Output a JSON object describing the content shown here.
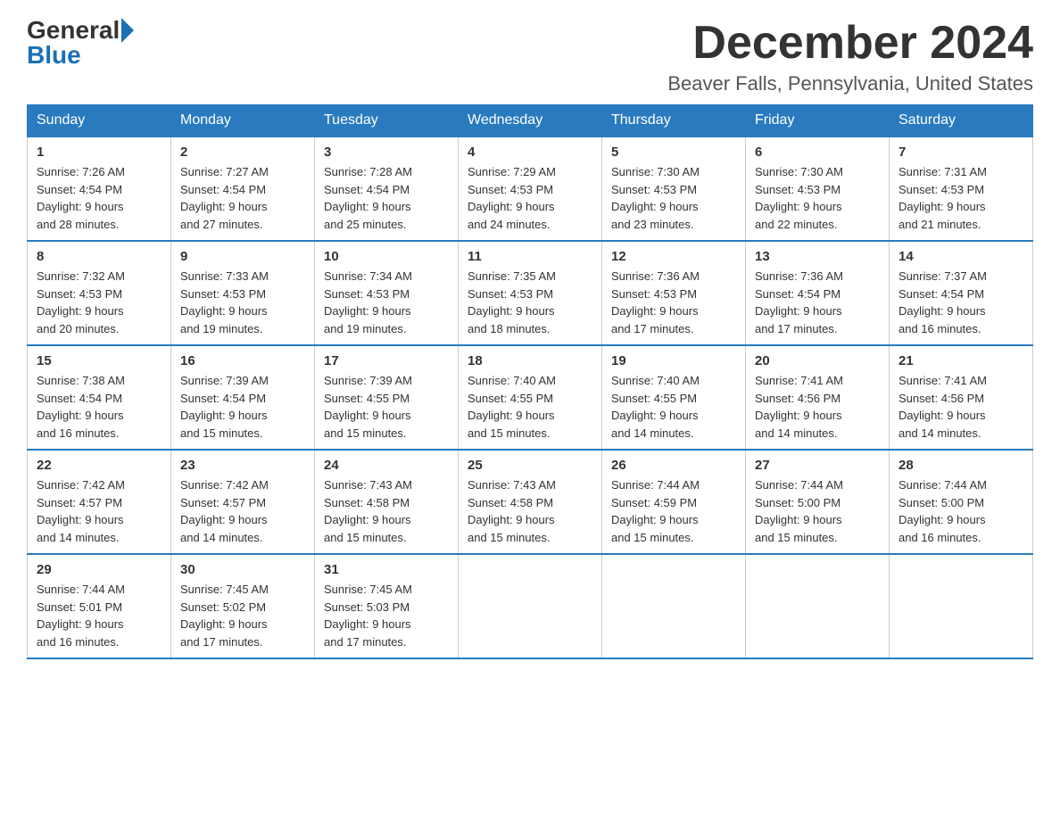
{
  "header": {
    "logo_general": "General",
    "logo_blue": "Blue",
    "month_title": "December 2024",
    "location": "Beaver Falls, Pennsylvania, United States"
  },
  "days_of_week": [
    "Sunday",
    "Monday",
    "Tuesday",
    "Wednesday",
    "Thursday",
    "Friday",
    "Saturday"
  ],
  "weeks": [
    [
      {
        "day": "1",
        "sunrise": "7:26 AM",
        "sunset": "4:54 PM",
        "daylight": "9 hours and 28 minutes."
      },
      {
        "day": "2",
        "sunrise": "7:27 AM",
        "sunset": "4:54 PM",
        "daylight": "9 hours and 27 minutes."
      },
      {
        "day": "3",
        "sunrise": "7:28 AM",
        "sunset": "4:54 PM",
        "daylight": "9 hours and 25 minutes."
      },
      {
        "day": "4",
        "sunrise": "7:29 AM",
        "sunset": "4:53 PM",
        "daylight": "9 hours and 24 minutes."
      },
      {
        "day": "5",
        "sunrise": "7:30 AM",
        "sunset": "4:53 PM",
        "daylight": "9 hours and 23 minutes."
      },
      {
        "day": "6",
        "sunrise": "7:30 AM",
        "sunset": "4:53 PM",
        "daylight": "9 hours and 22 minutes."
      },
      {
        "day": "7",
        "sunrise": "7:31 AM",
        "sunset": "4:53 PM",
        "daylight": "9 hours and 21 minutes."
      }
    ],
    [
      {
        "day": "8",
        "sunrise": "7:32 AM",
        "sunset": "4:53 PM",
        "daylight": "9 hours and 20 minutes."
      },
      {
        "day": "9",
        "sunrise": "7:33 AM",
        "sunset": "4:53 PM",
        "daylight": "9 hours and 19 minutes."
      },
      {
        "day": "10",
        "sunrise": "7:34 AM",
        "sunset": "4:53 PM",
        "daylight": "9 hours and 19 minutes."
      },
      {
        "day": "11",
        "sunrise": "7:35 AM",
        "sunset": "4:53 PM",
        "daylight": "9 hours and 18 minutes."
      },
      {
        "day": "12",
        "sunrise": "7:36 AM",
        "sunset": "4:53 PM",
        "daylight": "9 hours and 17 minutes."
      },
      {
        "day": "13",
        "sunrise": "7:36 AM",
        "sunset": "4:54 PM",
        "daylight": "9 hours and 17 minutes."
      },
      {
        "day": "14",
        "sunrise": "7:37 AM",
        "sunset": "4:54 PM",
        "daylight": "9 hours and 16 minutes."
      }
    ],
    [
      {
        "day": "15",
        "sunrise": "7:38 AM",
        "sunset": "4:54 PM",
        "daylight": "9 hours and 16 minutes."
      },
      {
        "day": "16",
        "sunrise": "7:39 AM",
        "sunset": "4:54 PM",
        "daylight": "9 hours and 15 minutes."
      },
      {
        "day": "17",
        "sunrise": "7:39 AM",
        "sunset": "4:55 PM",
        "daylight": "9 hours and 15 minutes."
      },
      {
        "day": "18",
        "sunrise": "7:40 AM",
        "sunset": "4:55 PM",
        "daylight": "9 hours and 15 minutes."
      },
      {
        "day": "19",
        "sunrise": "7:40 AM",
        "sunset": "4:55 PM",
        "daylight": "9 hours and 14 minutes."
      },
      {
        "day": "20",
        "sunrise": "7:41 AM",
        "sunset": "4:56 PM",
        "daylight": "9 hours and 14 minutes."
      },
      {
        "day": "21",
        "sunrise": "7:41 AM",
        "sunset": "4:56 PM",
        "daylight": "9 hours and 14 minutes."
      }
    ],
    [
      {
        "day": "22",
        "sunrise": "7:42 AM",
        "sunset": "4:57 PM",
        "daylight": "9 hours and 14 minutes."
      },
      {
        "day": "23",
        "sunrise": "7:42 AM",
        "sunset": "4:57 PM",
        "daylight": "9 hours and 14 minutes."
      },
      {
        "day": "24",
        "sunrise": "7:43 AM",
        "sunset": "4:58 PM",
        "daylight": "9 hours and 15 minutes."
      },
      {
        "day": "25",
        "sunrise": "7:43 AM",
        "sunset": "4:58 PM",
        "daylight": "9 hours and 15 minutes."
      },
      {
        "day": "26",
        "sunrise": "7:44 AM",
        "sunset": "4:59 PM",
        "daylight": "9 hours and 15 minutes."
      },
      {
        "day": "27",
        "sunrise": "7:44 AM",
        "sunset": "5:00 PM",
        "daylight": "9 hours and 15 minutes."
      },
      {
        "day": "28",
        "sunrise": "7:44 AM",
        "sunset": "5:00 PM",
        "daylight": "9 hours and 16 minutes."
      }
    ],
    [
      {
        "day": "29",
        "sunrise": "7:44 AM",
        "sunset": "5:01 PM",
        "daylight": "9 hours and 16 minutes."
      },
      {
        "day": "30",
        "sunrise": "7:45 AM",
        "sunset": "5:02 PM",
        "daylight": "9 hours and 17 minutes."
      },
      {
        "day": "31",
        "sunrise": "7:45 AM",
        "sunset": "5:03 PM",
        "daylight": "9 hours and 17 minutes."
      },
      null,
      null,
      null,
      null
    ]
  ],
  "labels": {
    "sunrise": "Sunrise:",
    "sunset": "Sunset:",
    "daylight": "Daylight:"
  }
}
